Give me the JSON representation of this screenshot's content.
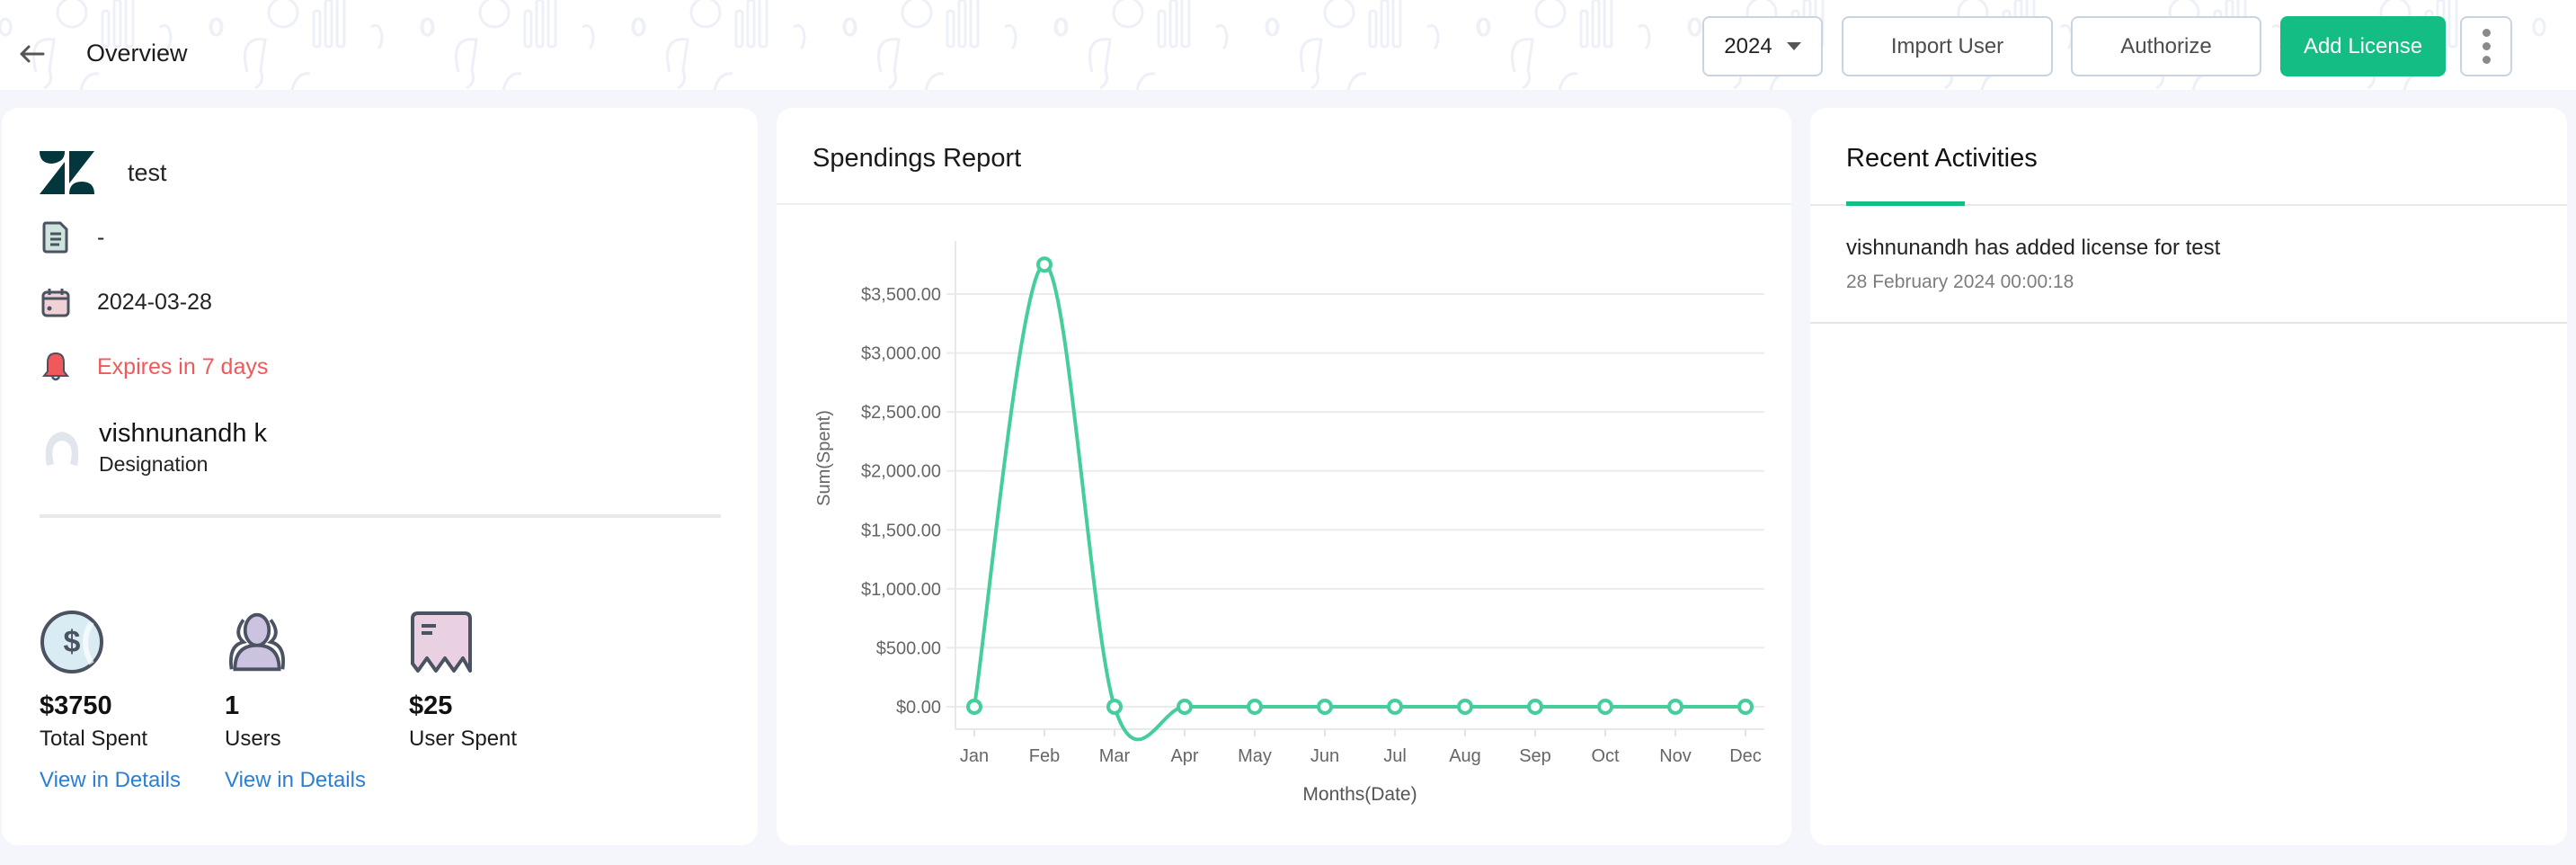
{
  "header": {
    "title": "Overview",
    "back_icon": "arrow-left-icon",
    "year_select": {
      "value": "2024"
    },
    "buttons": {
      "import_user": "Import User",
      "authorize": "Authorize",
      "add_license": "Add License"
    },
    "more_icon": "kebab-vertical-icon"
  },
  "colors": {
    "accent": "#14bd83",
    "chart_line": "#46cd9c",
    "expiry_red": "#f0595a",
    "link_blue": "#2a7fd4",
    "logo_dark": "#03363d"
  },
  "info": {
    "app_name": "test",
    "app_logo": "zendesk-logo",
    "description": "-",
    "date": "2024-03-28",
    "expiry": "Expires in 7 days",
    "owner": {
      "name": "vishnunandh k",
      "designation": "Designation"
    }
  },
  "stats": [
    {
      "icon": "dollar-coin-icon",
      "value": "$3750",
      "label": "Total Spent",
      "link": "View in Details"
    },
    {
      "icon": "users-icon",
      "value": "1",
      "label": "Users",
      "link": "View in Details"
    },
    {
      "icon": "receipt-icon",
      "value": "$25",
      "label": "User Spent"
    }
  ],
  "spendings": {
    "title": "Spendings Report"
  },
  "chart_data": {
    "type": "line",
    "title": "Spendings Report",
    "xlabel": "Months(Date)",
    "ylabel": "Sum(Spent)",
    "categories": [
      "Jan",
      "Feb",
      "Mar",
      "Apr",
      "May",
      "Jun",
      "Jul",
      "Aug",
      "Sep",
      "Oct",
      "Nov",
      "Dec"
    ],
    "series": [
      {
        "name": "Sum(Spent)",
        "values": [
          0,
          3750,
          0,
          0,
          0,
          0,
          0,
          0,
          0,
          0,
          0,
          0
        ]
      }
    ],
    "yticks": [
      0,
      500,
      1000,
      1500,
      2000,
      2500,
      3000,
      3500
    ],
    "ytick_labels": [
      "$0.00",
      "$500.00",
      "$1,000.00",
      "$1,500.00",
      "$2,000.00",
      "$2,500.00",
      "$3,000.00",
      "$3,500.00"
    ],
    "ylim": [
      -200,
      3950
    ],
    "grid": true,
    "smooth": true
  },
  "activities": {
    "title": "Recent Activities",
    "items": [
      {
        "message": "vishnunandh has added license for test",
        "time": "28 February 2024 00:00:18"
      }
    ]
  }
}
